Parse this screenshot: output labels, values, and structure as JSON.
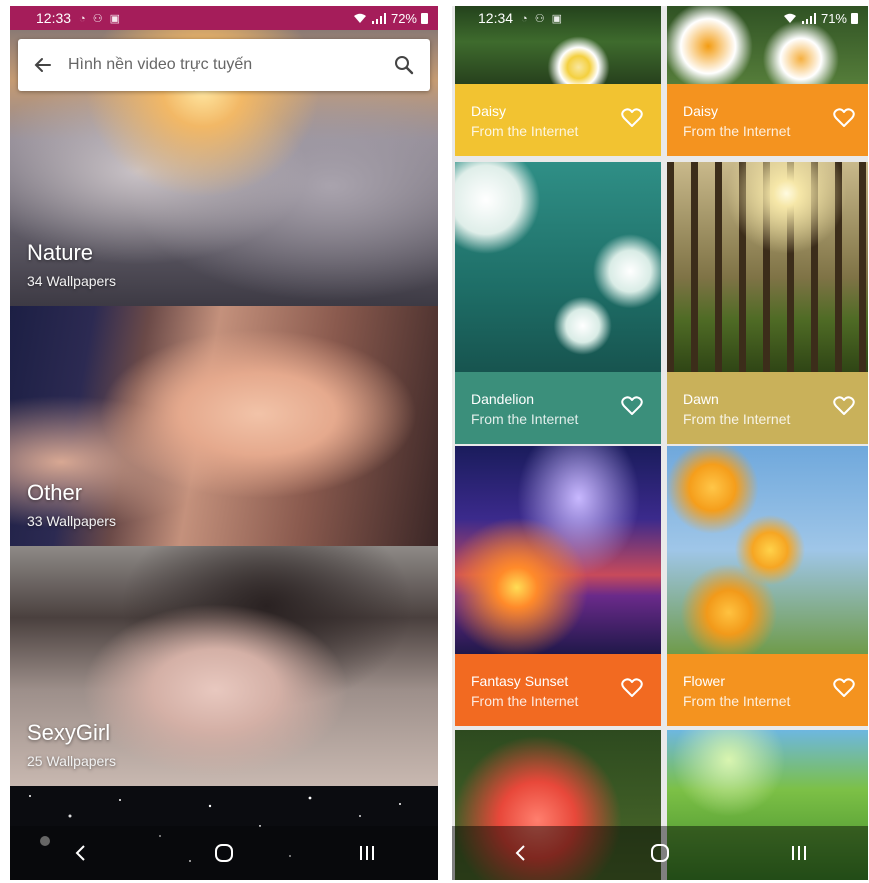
{
  "left_screen": {
    "status_bar": {
      "time": "12:33",
      "battery_percent": "72%"
    },
    "search": {
      "placeholder": "Hình nền video trực tuyến"
    },
    "categories": [
      {
        "name": "Nature",
        "count": "34 Wallpapers"
      },
      {
        "name": "Other",
        "count": "33 Wallpapers"
      },
      {
        "name": "SexyGirl",
        "count": "25 Wallpapers"
      }
    ]
  },
  "right_screen": {
    "status_bar": {
      "time": "12:34",
      "battery_percent": "71%"
    },
    "wallpapers": [
      {
        "title": "Daisy",
        "source": "From the Internet"
      },
      {
        "title": "Daisy",
        "source": "From the Internet"
      },
      {
        "title": "Dandelion",
        "source": "From the Internet"
      },
      {
        "title": "Dawn",
        "source": "From the Internet"
      },
      {
        "title": "Fantasy Sunset",
        "source": "From the Internet"
      },
      {
        "title": "Flower",
        "source": "From the Internet"
      }
    ]
  },
  "icons": {
    "back": "arrow-left-icon",
    "search": "search-icon",
    "favorite": "heart-outline-icon",
    "nav_back": "chevron-left-icon",
    "nav_home": "home-circle-icon",
    "nav_recents": "recents-icon"
  },
  "colors": {
    "status_bar_left": "#a51d5a",
    "daisy_yellow": "#f2c331",
    "orange": "#f4931f",
    "teal": "#3b8f7b",
    "olive": "#c9b15a",
    "fantasy_orange": "#f26a21"
  }
}
